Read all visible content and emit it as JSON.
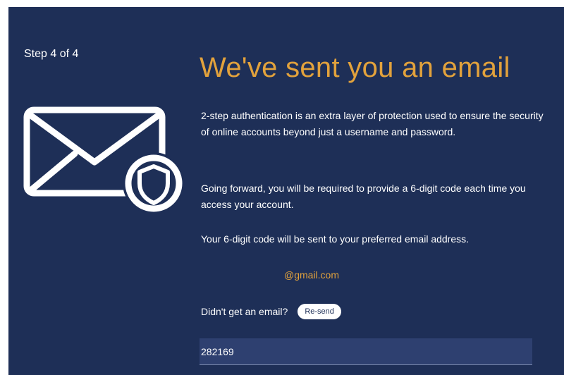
{
  "step": {
    "label": "Step 4 of 4"
  },
  "header": {
    "title": "We've sent you an email"
  },
  "content": {
    "paragraph_1": "2-step authentication is an extra layer of protection used to ensure the security of online accounts beyond just a username and password.",
    "paragraph_2": "Going forward, you will be required to provide a 6-digit code each time you access your account.",
    "paragraph_3": "Your 6-digit code will be sent to your preferred email address.",
    "email": "@gmail.com"
  },
  "resend": {
    "label": "Didn't get an email?",
    "button_label": "Re-send"
  },
  "code_input": {
    "value": "282169"
  },
  "icons": {
    "envelope": "envelope-shield-icon"
  },
  "colors": {
    "background": "#1e2f57",
    "accent": "#e2a23c",
    "text": "#ffffff",
    "input_background": "#2e4070"
  }
}
